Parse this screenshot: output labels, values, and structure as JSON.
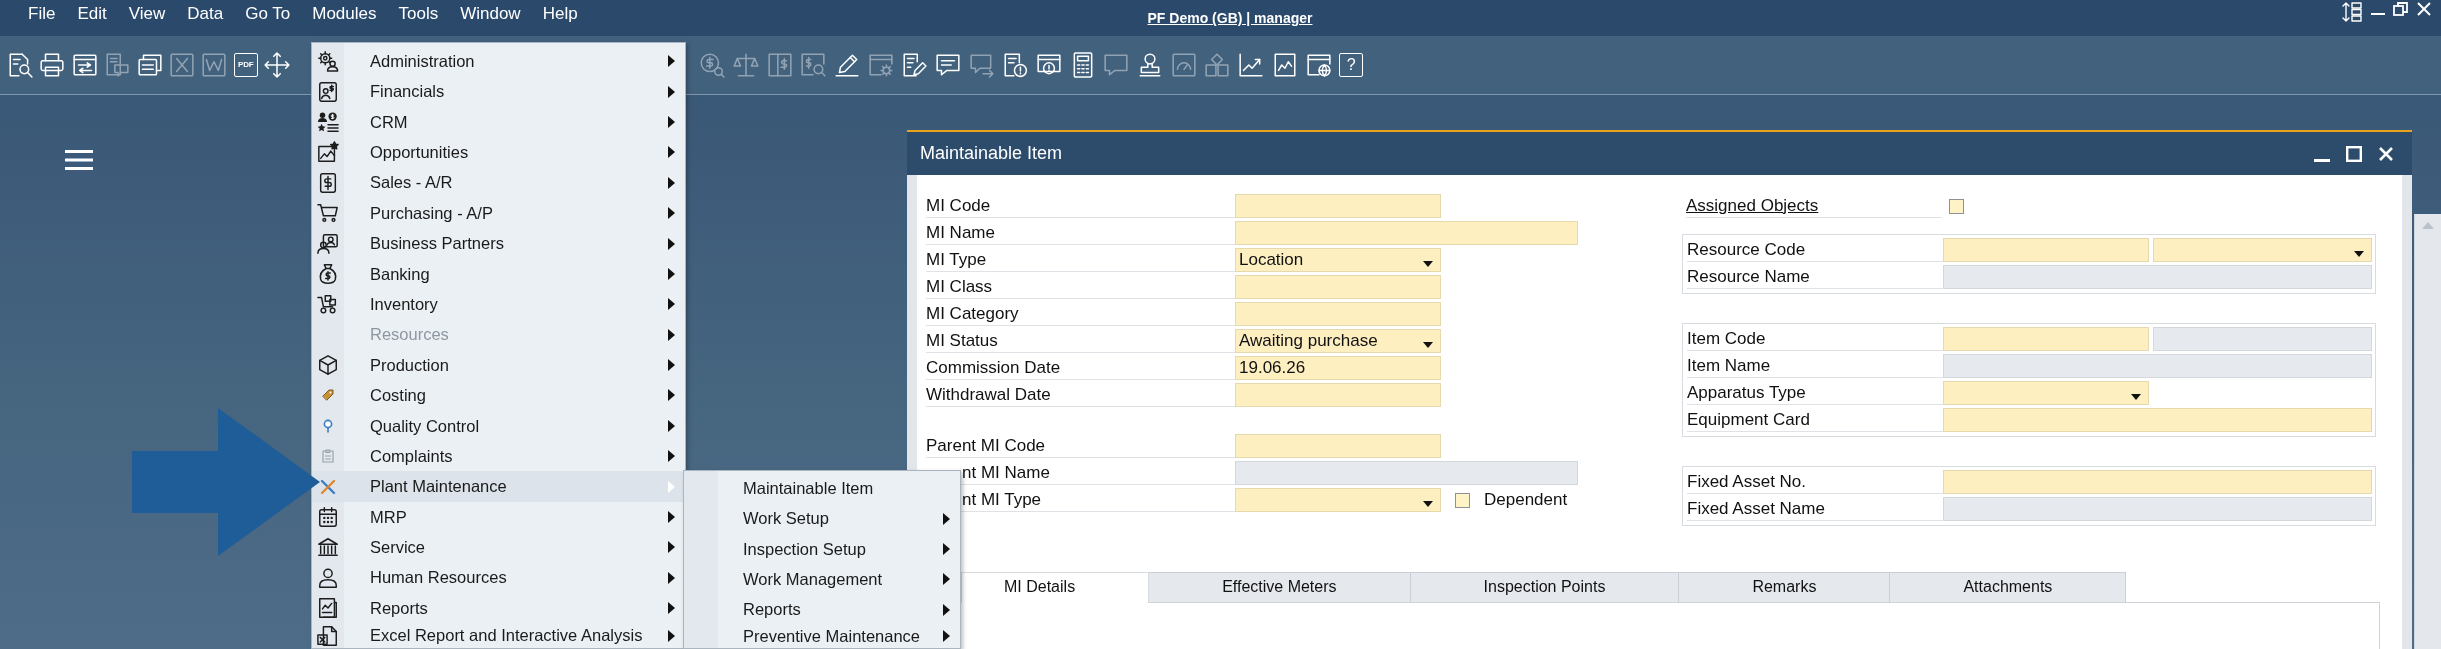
{
  "menu_bar": {
    "items": [
      "File",
      "Edit",
      "View",
      "Data",
      "Go To",
      "Modules",
      "Tools",
      "Window",
      "Help"
    ],
    "session": "PF Demo (GB) | manager"
  },
  "toolbar": {
    "groups": [
      [
        {
          "disabled": false
        },
        {
          "disabled": false
        },
        {
          "disabled": false
        },
        {
          "disabled": true
        },
        {
          "disabled": false
        },
        {
          "disabled": true
        },
        {
          "disabled": true
        },
        {
          "disabled": false,
          "label": "PDF"
        },
        {
          "disabled": false
        }
      ],
      [
        {
          "disabled": true
        },
        {
          "disabled": true
        },
        {
          "disabled": true
        },
        {
          "disabled": true
        },
        {
          "disabled": false
        },
        {
          "disabled": true
        },
        {
          "disabled": false
        },
        {
          "disabled": false
        },
        {
          "disabled": true
        },
        {
          "disabled": false
        },
        {
          "disabled": false
        },
        {
          "disabled": false
        },
        {
          "disabled": true
        },
        {
          "disabled": false
        },
        {
          "disabled": true
        },
        {
          "disabled": true
        },
        {
          "disabled": false
        },
        {
          "disabled": false
        },
        {
          "disabled": false
        },
        {
          "disabled": false,
          "label": "?"
        }
      ]
    ]
  },
  "modules_menu": {
    "items": [
      {
        "label": "Administration",
        "disabled": false,
        "selected": false,
        "submenu": true
      },
      {
        "label": "Financials",
        "disabled": false,
        "selected": false,
        "submenu": true
      },
      {
        "label": "CRM",
        "disabled": false,
        "selected": false,
        "submenu": true
      },
      {
        "label": "Opportunities",
        "disabled": false,
        "selected": false,
        "submenu": true
      },
      {
        "label": "Sales - A/R",
        "disabled": false,
        "selected": false,
        "submenu": true
      },
      {
        "label": "Purchasing - A/P",
        "disabled": false,
        "selected": false,
        "submenu": true
      },
      {
        "label": "Business Partners",
        "disabled": false,
        "selected": false,
        "submenu": true
      },
      {
        "label": "Banking",
        "disabled": false,
        "selected": false,
        "submenu": true
      },
      {
        "label": "Inventory",
        "disabled": false,
        "selected": false,
        "submenu": true
      },
      {
        "label": "Resources",
        "disabled": true,
        "selected": false,
        "submenu": true
      },
      {
        "label": "Production",
        "disabled": false,
        "selected": false,
        "submenu": true
      },
      {
        "label": "Costing",
        "disabled": false,
        "selected": false,
        "submenu": true
      },
      {
        "label": "Quality Control",
        "disabled": false,
        "selected": false,
        "submenu": true
      },
      {
        "label": "Complaints",
        "disabled": false,
        "selected": false,
        "submenu": true
      },
      {
        "label": "Plant Maintenance",
        "disabled": false,
        "selected": true,
        "submenu": true
      },
      {
        "label": "MRP",
        "disabled": false,
        "selected": false,
        "submenu": true
      },
      {
        "label": "Service",
        "disabled": false,
        "selected": false,
        "submenu": true
      },
      {
        "label": "Human Resources",
        "disabled": false,
        "selected": false,
        "submenu": true
      },
      {
        "label": "Reports",
        "disabled": false,
        "selected": false,
        "submenu": true
      },
      {
        "label": "Excel Report and Interactive Analysis",
        "disabled": false,
        "selected": false,
        "submenu": true
      }
    ]
  },
  "plant_maintenance_menu": {
    "items": [
      {
        "label": "Maintainable Item",
        "submenu": false
      },
      {
        "label": "Work Setup",
        "submenu": true
      },
      {
        "label": "Inspection Setup",
        "submenu": true
      },
      {
        "label": "Work Management",
        "submenu": true
      },
      {
        "label": "Reports",
        "submenu": true
      },
      {
        "label": "Preventive Maintenance",
        "submenu": true
      }
    ]
  },
  "form": {
    "title": "Maintainable Item",
    "left_sections": [
      {
        "rows": [
          {
            "label": "MI Code",
            "kind": "short",
            "inputs": [
              {
                "kind": "text",
                "disabled": false
              }
            ]
          },
          {
            "label": "MI Name",
            "kind": "wide",
            "inputs": [
              {
                "kind": "text",
                "disabled": false
              }
            ]
          },
          {
            "label": "MI Type",
            "kind": "short",
            "inputs": [
              {
                "kind": "dropdown",
                "disabled": false,
                "value": "Location"
              }
            ]
          },
          {
            "label": "MI Class",
            "kind": "short",
            "inputs": [
              {
                "kind": "text",
                "disabled": false
              }
            ]
          },
          {
            "label": "MI Category",
            "kind": "short",
            "inputs": [
              {
                "kind": "text",
                "disabled": false
              }
            ]
          },
          {
            "label": "MI Status",
            "kind": "short",
            "inputs": [
              {
                "kind": "dropdown",
                "disabled": false,
                "value": "Awaiting purchase"
              }
            ]
          },
          {
            "label": "Commission Date",
            "kind": "short",
            "inputs": [
              {
                "kind": "text",
                "disabled": false,
                "value": "19.06.26"
              }
            ]
          },
          {
            "label": "Withdrawal Date",
            "kind": "short",
            "inputs": [
              {
                "kind": "text",
                "disabled": false
              }
            ]
          }
        ]
      },
      {
        "rows": [
          {
            "label": "Parent MI Code",
            "kind": "short",
            "inputs": [
              {
                "kind": "text",
                "disabled": false
              }
            ]
          },
          {
            "label": "nt MI Name",
            "kind": "wide",
            "inputs": [
              {
                "kind": "text",
                "disabled": true
              }
            ]
          },
          {
            "label": "nt MI Type",
            "kind": "short",
            "inputs": [
              {
                "kind": "dropdown",
                "disabled": false
              }
            ],
            "checkbox": {
              "label": "Dependent",
              "checked": false
            }
          }
        ]
      }
    ],
    "assigned_objects": {
      "label": "Assigned Objects",
      "checked": false
    },
    "right_sections": [
      {
        "rows": [
          {
            "label": "Resource Code",
            "kind": "split",
            "inputs": [
              {
                "kind": "text",
                "disabled": false
              },
              {
                "kind": "dropdown",
                "disabled": false
              }
            ]
          },
          {
            "label": "Resource Name",
            "kind": "wide",
            "inputs": [
              {
                "kind": "text",
                "disabled": true
              }
            ]
          }
        ]
      },
      {
        "rows": [
          {
            "label": "Item Code",
            "kind": "split",
            "inputs": [
              {
                "kind": "text",
                "disabled": false
              },
              {
                "kind": "text",
                "disabled": true
              }
            ]
          },
          {
            "label": "Item Name",
            "kind": "wide",
            "inputs": [
              {
                "kind": "text",
                "disabled": true
              }
            ]
          },
          {
            "label": "Apparatus Type",
            "kind": "short",
            "inputs": [
              {
                "kind": "dropdown",
                "disabled": false
              }
            ]
          },
          {
            "label": "Equipment Card",
            "kind": "wide",
            "inputs": [
              {
                "kind": "text",
                "disabled": false
              }
            ]
          }
        ]
      },
      {
        "rows": [
          {
            "label": "Fixed Asset No.",
            "kind": "wide",
            "inputs": [
              {
                "kind": "text",
                "disabled": false
              }
            ]
          },
          {
            "label": "Fixed Asset Name",
            "kind": "wide",
            "inputs": [
              {
                "kind": "text",
                "disabled": true
              }
            ]
          }
        ]
      }
    ],
    "tabs": [
      {
        "label": "MI Details",
        "selected": true
      },
      {
        "label": "Effective Meters",
        "selected": false
      },
      {
        "label": "Inspection Points",
        "selected": false
      },
      {
        "label": "Remarks",
        "selected": false
      },
      {
        "label": "Attachments",
        "selected": false
      }
    ]
  }
}
